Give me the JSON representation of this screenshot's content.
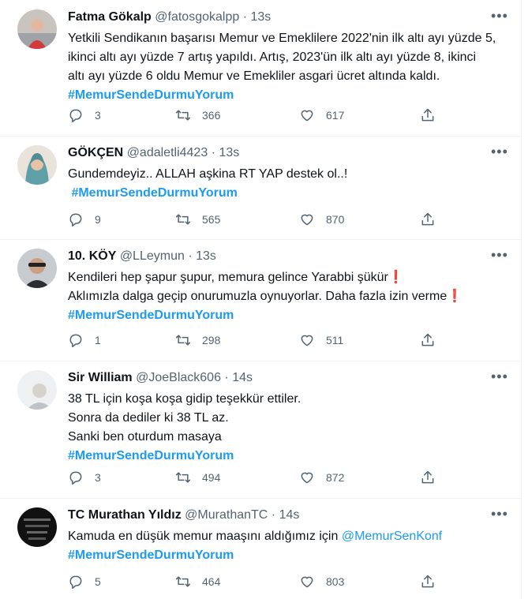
{
  "tweets": [
    {
      "name": "Fatma Gökalp",
      "handle": "@fatosgokalpp",
      "time": "13s",
      "lines": [
        "Yetkili Sendikanın başarısı Memur ve Emeklilere 2022'nin ilk altı ayı yüzde 5,",
        "ikinci altı ayı yüzde 7 artış yapıldı. Artış, 2023'ün ilk altı ayı yüzde 8, ikinci",
        "altı ayı yüzde 6 oldu  Memur ve Emekliler asgari ücret altında kaldı."
      ],
      "hashtag": "#MemurSendeDurmuYorum",
      "replies": "3",
      "retweets": "366",
      "likes": "617"
    },
    {
      "name": "GÖKÇEN",
      "handle": "@adaletli4423",
      "time": "13s",
      "lines": [
        "Gundemdeyiz.. ALLAH aşkina RT YAP destek ol..!"
      ],
      "hashtag": " #MemurSendeDurmuYorum",
      "replies": "9",
      "retweets": "565",
      "likes": "870"
    },
    {
      "name": "10. KÖY",
      "handle": "@LLeymun",
      "time": "13s",
      "lines": [
        "Kendileri hep şapur şupur, memura gelince Yarabbi şükür",
        "Aklımızla dalga geçip onurumuzla oynuyorlar. Daha fazla izin verme"
      ],
      "excl": "❗",
      "hashtag": "#MemurSendeDurmuYorum",
      "replies": "1",
      "retweets": "298",
      "likes": "511"
    },
    {
      "name": "Sir William",
      "handle": "@JoeBlack606",
      "time": "14s",
      "lines": [
        "38 TL için koşa koşa gidip teşekkür ettiler.",
        "Sonra da dediler ki 38 TL az.",
        "Sanki ben oturdum masaya"
      ],
      "hashtag": "#MemurSendeDurmuYorum",
      "replies": "3",
      "retweets": "494",
      "likes": "872"
    },
    {
      "name": "TC Murathan Yıldız",
      "handle": "@MurathanTC",
      "time": "14s",
      "lines": [
        "Kamuda en düşük memur maaşını aldığımız için"
      ],
      "mention": "@MemurSenKonf",
      "hashtag": "#MemurSendeDurmuYorum",
      "replies": "5",
      "retweets": "464",
      "likes": "803"
    }
  ],
  "ui": {
    "dot": "·",
    "more": "•••"
  },
  "colors": {
    "link": "#1d9bf0",
    "muted": "#536471",
    "text": "#0f1419",
    "divider": "#eff3f4"
  }
}
